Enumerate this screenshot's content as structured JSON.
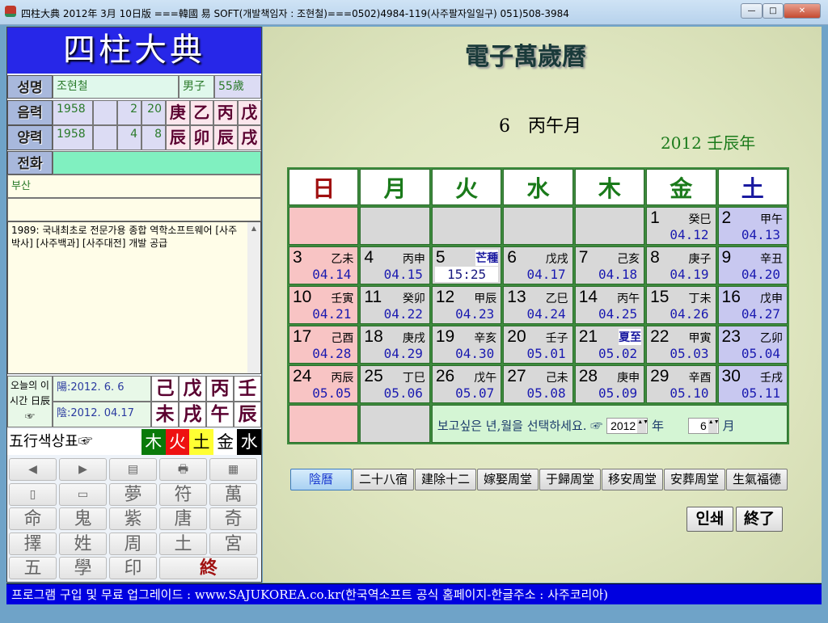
{
  "window": {
    "title": "四柱大典 2012年 3月 10日版 ===韓國 易 SOFT(개발책임자 : 조현철)===0502)4984-119(사주팔자일일구) 051)508-3984",
    "min": "—",
    "max": "□",
    "close": "✕"
  },
  "left": {
    "logo": "四柱大典",
    "name_label": "성명",
    "name": "조현철",
    "gender": "男子",
    "age": "55歲",
    "lunar_label": "음력",
    "lunar": {
      "year": "1958",
      "blank": "",
      "month": "2",
      "day": "20"
    },
    "solar_label": "양력",
    "solar": {
      "year": "1958",
      "blank": "",
      "month": "4",
      "day": "8"
    },
    "stems": [
      "庚",
      "乙",
      "丙",
      "戊"
    ],
    "branches": [
      "辰",
      "卯",
      "辰",
      "戌"
    ],
    "phone_label": "전화",
    "phone": "",
    "address": "부산",
    "address2": "",
    "memo": "1989: 국내최초로 전문가용 종합 역학소프트웨어 [사주박사] [사주백과] [사주대전] 개발 공급",
    "today_label": "오늘의 이시간 日辰☞",
    "today_solar": "陽:2012.  6. 6",
    "today_lunar": "陰:2012. 04.17",
    "today_stems": [
      "己",
      "戊",
      "丙",
      "壬"
    ],
    "today_branches": [
      "未",
      "戌",
      "午",
      "辰"
    ],
    "five_label": "五行색상표☞",
    "five": [
      {
        "t": "木",
        "bg": "#0a7a0a",
        "fg": "#fff"
      },
      {
        "t": "火",
        "bg": "#ee1111",
        "fg": "#fff"
      },
      {
        "t": "土",
        "bg": "#ffff33",
        "fg": "#000"
      },
      {
        "t": "金",
        "bg": "#ffffff",
        "fg": "#000"
      },
      {
        "t": "水",
        "bg": "#000000",
        "fg": "#fff"
      }
    ],
    "grid": [
      [
        "◀",
        "▶",
        "▤",
        "🖶",
        "▦"
      ],
      [
        "▯",
        "▭",
        "夢",
        "符",
        "萬"
      ],
      [
        "命",
        "鬼",
        "紫",
        "唐",
        "奇"
      ],
      [
        "擇",
        "姓",
        "周",
        "土",
        "宮"
      ],
      [
        "五",
        "學",
        "印",
        "終"
      ]
    ]
  },
  "calendar": {
    "title": "電子萬歲曆",
    "month": "6　丙午月",
    "year": "2012 壬辰年",
    "weekdays": [
      "日",
      "月",
      "火",
      "水",
      "木",
      "金",
      "土"
    ],
    "weekday_colors": [
      "#a01010",
      "#1a7a1a",
      "#1a7a1a",
      "#1a7a1a",
      "#1a7a1a",
      "#1a7a1a",
      "#1a1aa0"
    ],
    "col_colors": [
      "#f8c4c4",
      "#d8d8d8",
      "#d8d8d8",
      "#d8d8d8",
      "#d8d8d8",
      "#d8d8d8",
      "#c8c8f0"
    ],
    "weeks": [
      [
        null,
        null,
        null,
        null,
        null,
        {
          "d": "1",
          "g": "癸巳",
          "l": "04.12"
        },
        {
          "d": "2",
          "g": "甲午",
          "l": "04.13"
        }
      ],
      [
        {
          "d": "3",
          "g": "乙未",
          "l": "04.14"
        },
        {
          "d": "4",
          "g": "丙申",
          "l": "04.15"
        },
        {
          "d": "5",
          "term": "芒種",
          "l": "15:25",
          "hl": true
        },
        {
          "d": "6",
          "g": "戊戌",
          "l": "04.17"
        },
        {
          "d": "7",
          "g": "己亥",
          "l": "04.18"
        },
        {
          "d": "8",
          "g": "庚子",
          "l": "04.19"
        },
        {
          "d": "9",
          "g": "辛丑",
          "l": "04.20"
        }
      ],
      [
        {
          "d": "10",
          "g": "壬寅",
          "l": "04.21"
        },
        {
          "d": "11",
          "g": "癸卯",
          "l": "04.22"
        },
        {
          "d": "12",
          "g": "甲辰",
          "l": "04.23"
        },
        {
          "d": "13",
          "g": "乙巳",
          "l": "04.24"
        },
        {
          "d": "14",
          "g": "丙午",
          "l": "04.25"
        },
        {
          "d": "15",
          "g": "丁未",
          "l": "04.26"
        },
        {
          "d": "16",
          "g": "戊申",
          "l": "04.27"
        }
      ],
      [
        {
          "d": "17",
          "g": "己酉",
          "l": "04.28"
        },
        {
          "d": "18",
          "g": "庚戌",
          "l": "04.29"
        },
        {
          "d": "19",
          "g": "辛亥",
          "l": "04.30"
        },
        {
          "d": "20",
          "g": "壬子",
          "l": "05.01"
        },
        {
          "d": "21",
          "term": "夏至",
          "l": "05.02"
        },
        {
          "d": "22",
          "g": "甲寅",
          "l": "05.03"
        },
        {
          "d": "23",
          "g": "乙卯",
          "l": "05.04"
        }
      ],
      [
        {
          "d": "24",
          "g": "丙辰",
          "l": "05.05"
        },
        {
          "d": "25",
          "g": "丁巳",
          "l": "05.06"
        },
        {
          "d": "26",
          "g": "戊午",
          "l": "05.07"
        },
        {
          "d": "27",
          "g": "己未",
          "l": "05.08"
        },
        {
          "d": "28",
          "g": "庚申",
          "l": "05.09"
        },
        {
          "d": "29",
          "g": "辛酉",
          "l": "05.10"
        },
        {
          "d": "30",
          "g": "壬戌",
          "l": "05.11"
        }
      ]
    ],
    "select_prompt": "보고싶은 년,월을 선택하세요. ☞",
    "year_value": "2012",
    "year_unit": "年",
    "month_value": "6",
    "month_unit": "月"
  },
  "tabs": [
    "陰曆",
    "二十八宿",
    "建除十二",
    "嫁娶周堂",
    "于歸周堂",
    "移安周堂",
    "安葬周堂",
    "生氣福德"
  ],
  "actions": {
    "print": "인쇄",
    "exit": "終了"
  },
  "footer": "프로그램 구입 및 무료 업그레이드 : www.SAJUKOREA.co.kr(한국역소프트 공식 홈페이지-한글주소 : 사주코리아)"
}
